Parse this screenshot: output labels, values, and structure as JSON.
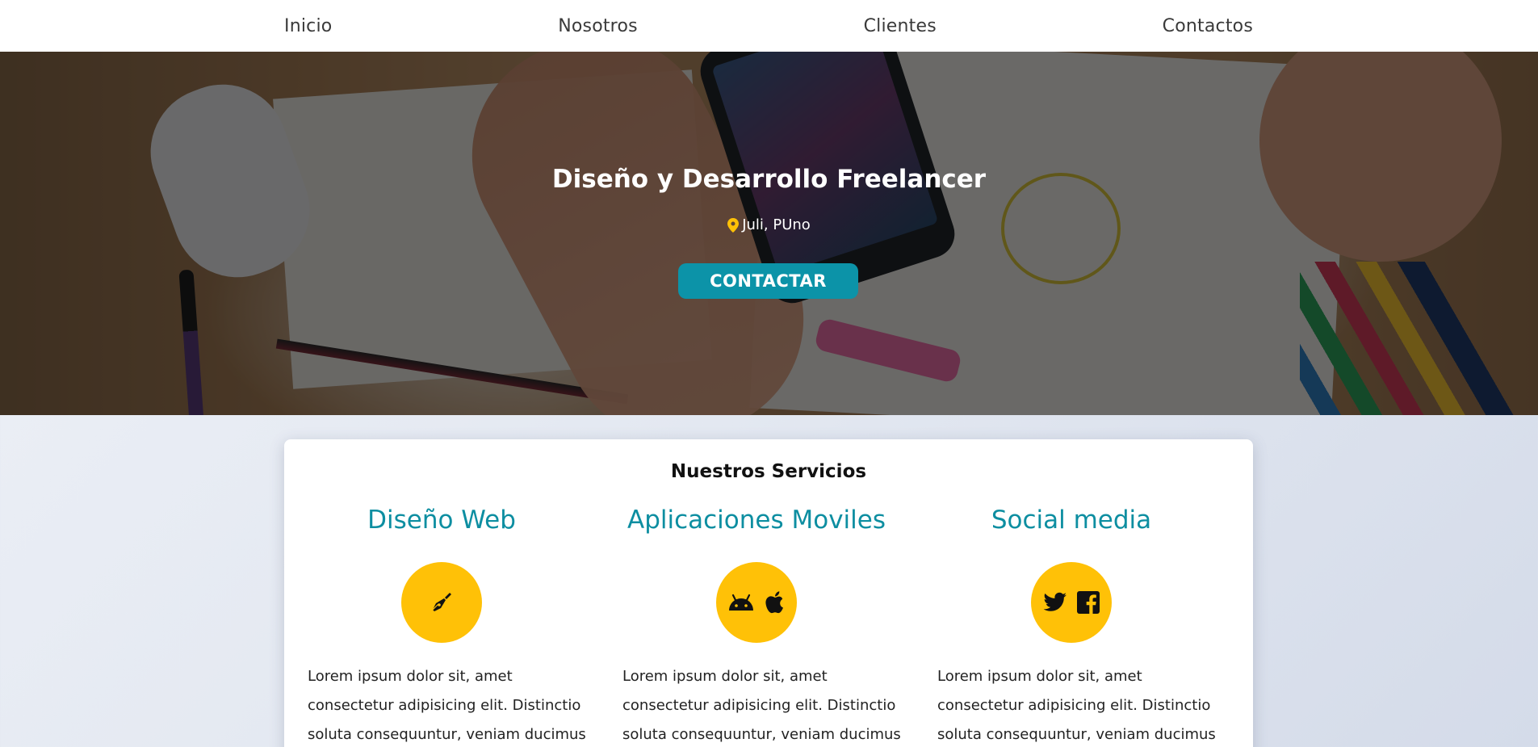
{
  "nav": {
    "items": [
      {
        "label": "Inicio"
      },
      {
        "label": "Nosotros"
      },
      {
        "label": "Clientes"
      },
      {
        "label": "Contactos"
      }
    ]
  },
  "hero": {
    "title": "Diseño y Desarrollo Freelancer",
    "location": "Juli, PUno",
    "location_icon": "map-pin-icon",
    "cta_label": "CONTACTAR"
  },
  "services": {
    "title": "Nuestros Servicios",
    "items": [
      {
        "heading": "Diseño Web",
        "icons": [
          "pen-nib-icon"
        ],
        "text": "Lorem ipsum dolor sit, amet consectetur adipisicing elit. Distinctio soluta consequuntur, veniam ducimus autem"
      },
      {
        "heading": "Aplicaciones Moviles",
        "icons": [
          "android-icon",
          "apple-icon"
        ],
        "text": "Lorem ipsum dolor sit, amet consectetur adipisicing elit. Distinctio soluta consequuntur, veniam ducimus autem"
      },
      {
        "heading": "Social media",
        "icons": [
          "twitter-icon",
          "facebook-icon"
        ],
        "text": "Lorem ipsum dolor sit, amet consectetur adipisicing elit. Distinctio soluta consequuntur, veniam ducimus autem"
      }
    ]
  },
  "colors": {
    "accent": "#0c93a8",
    "heading_teal": "#0d8ea1",
    "icon_circle": "#ffc107",
    "pin": "#ffc107"
  }
}
